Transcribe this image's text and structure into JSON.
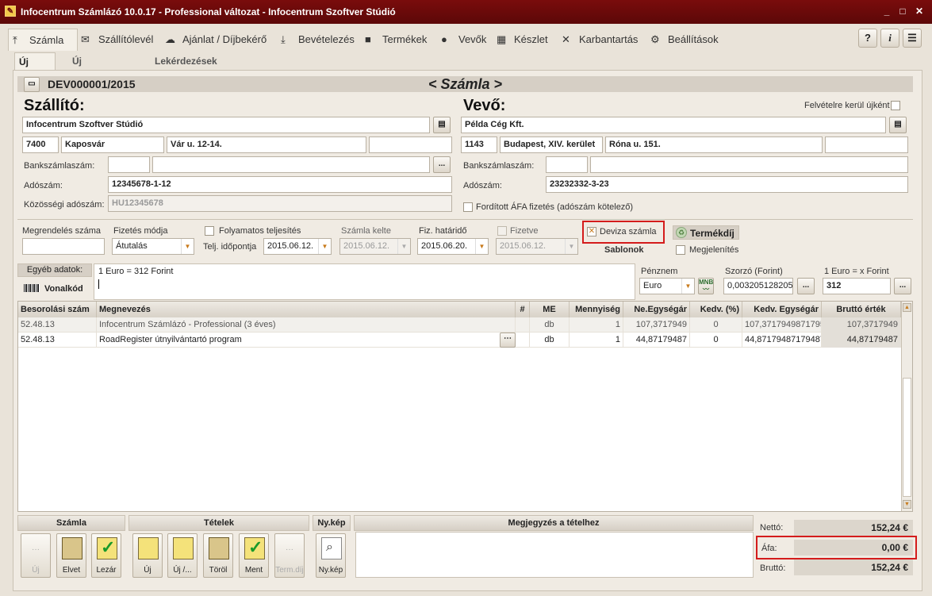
{
  "window": {
    "title": "Infocentrum Számlázó 10.0.17 - Professional változat - Infocentrum Szoftver Stúdió",
    "min_icon": "minimize-icon",
    "max_icon": "maximize-icon",
    "close_icon": "close-icon"
  },
  "menu": [
    {
      "label": "Számla",
      "icon": "⤒"
    },
    {
      "label": "Szállítólevél",
      "icon": "✉"
    },
    {
      "label": "Ajánlat / Díjbekérő",
      "icon": "☁"
    },
    {
      "label": "Bevételezés",
      "icon": "⤓"
    },
    {
      "label": "Termékek",
      "icon": "■"
    },
    {
      "label": "Vevők",
      "icon": "●"
    },
    {
      "label": "Készlet",
      "icon": "▦"
    },
    {
      "label": "Karbantartás",
      "icon": "✕"
    },
    {
      "label": "Beállítások",
      "icon": "⚙"
    }
  ],
  "right_buttons": {
    "help": "?",
    "info": "i",
    "list": "☰"
  },
  "subtabs": [
    "Új számla",
    "Új előleg számla",
    "Lekérdezések"
  ],
  "invoice": {
    "number": "DEV000001/2015",
    "title": "< Számla >"
  },
  "supplier": {
    "heading": "Szállító:",
    "name": "Infocentrum Szoftver Stúdió",
    "zip": "7400",
    "city": "Kaposvár",
    "street": "Vár u. 12-14.",
    "extra": "",
    "bank_label": "Bankszámlaszám:",
    "bank1": "",
    "bank2": "",
    "tax_label": "Adószám:",
    "tax": "12345678-1-12",
    "eu_label": "Közösségi adószám:",
    "eu_tax": "HU12345678"
  },
  "buyer": {
    "heading": "Vevő:",
    "new_label": "Felvételre kerül újként",
    "name": "Példa Cég Kft.",
    "zip": "1143",
    "city": "Budapest, XIV. kerület",
    "street": "Róna u. 151.",
    "extra": "",
    "bank_label": "Bankszámlaszám:",
    "bank1": "",
    "bank2": "",
    "tax_label": "Adószám:",
    "tax": "23232332-3-23",
    "reverse_label": "Fordított ÁFA fizetés (adószám kötelező)"
  },
  "order": {
    "order_label": "Megrendelés száma",
    "order_value": "",
    "payment_label": "Fizetés módja",
    "payment_value": "Átutalás",
    "continuous_label": "Folyamatos teljesítés",
    "perf_label": "Telj. időpontja",
    "perf_date": "2015.06.12.",
    "issue_label": "Számla kelte",
    "issue_date": "2015.06.12.",
    "due_label": "Fiz. határidő",
    "due_date": "2015.06.20.",
    "paid_label": "Fizetve",
    "paid_date": "2015.06.12.",
    "foreign_label": "Deviza számla",
    "templates_label": "Sablonok",
    "fee_label": "Termékdíj",
    "display_label": "Megjelenítés"
  },
  "other": {
    "label": "Egyéb adatok:",
    "barcode_label": "Vonalkód",
    "text": "1 Euro = 312 Forint"
  },
  "currency": {
    "label": "Pénznem",
    "value": "Euro",
    "rate_label": "Szorzó (Forint)",
    "rate": "0,003205128205",
    "conv_label": "1 Euro = x Forint",
    "conv": "312"
  },
  "grid": {
    "columns": [
      "Besorolási szám",
      "Megnevezés",
      "#",
      "ME",
      "Mennyiség",
      "Ne.Egységár",
      "Kedv. (%)",
      "Kedv. Egységár",
      "Bruttó érték"
    ],
    "rows": [
      [
        "52.48.13",
        "Infocentrum Számlázó - Professional (3 éves)",
        "",
        "db",
        "1",
        "107,3717949",
        "0",
        "107,3717949871795",
        "107,3717949"
      ],
      [
        "52.48.13",
        "RoadRegister útnyilvántartó program",
        "",
        "db",
        "1",
        "44,87179487",
        "0",
        "44,87179487179487",
        "44,87179487"
      ]
    ]
  },
  "bottom": {
    "invoice_header": "Számla",
    "items_header": "Tételek",
    "image_header": "Ny.kép",
    "note_header": "Megjegyzés a tételhez",
    "invoice_buttons": [
      "Új",
      "Elvet",
      "Lezár"
    ],
    "item_buttons": [
      "Új",
      "Új /...",
      "Töröl",
      "Ment",
      "Term.díj"
    ],
    "image_button": "Ny.kép"
  },
  "totals": {
    "net_label": "Nettó:",
    "net": "152,24 €",
    "vat_label": "Áfa:",
    "vat": "0,00 €",
    "gross_label": "Bruttó:",
    "gross": "152,24 €"
  }
}
